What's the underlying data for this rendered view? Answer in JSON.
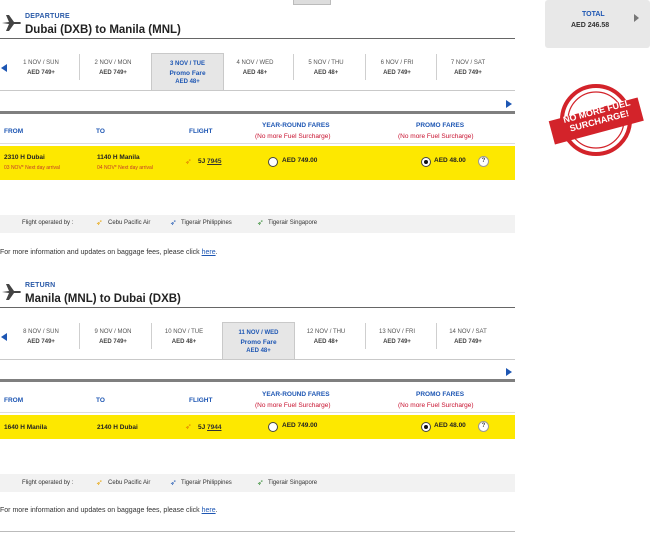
{
  "total": {
    "label": "TOTAL",
    "amount": "AED 246.58"
  },
  "stamp": {
    "line1": "NO MORE FUEL",
    "line2": "SURCHARGE!"
  },
  "departure": {
    "section_label": "DEPARTURE",
    "route": "Dubai (DXB) to Manila (MNL)",
    "dates": [
      {
        "date": "1 NOV / SUN",
        "price": "AED 749+"
      },
      {
        "date": "2 NOV / MON",
        "price": "AED 749+"
      },
      {
        "date": "3 NOV / TUE",
        "promo": "Promo Fare",
        "price": "AED 48+",
        "selected": true
      },
      {
        "date": "4 NOV / WED",
        "price": "AED 48+"
      },
      {
        "date": "5 NOV / THU",
        "price": "AED 48+"
      },
      {
        "date": "6 NOV / FRI",
        "price": "AED 749+"
      },
      {
        "date": "7 NOV / SAT",
        "price": "AED 749+"
      }
    ],
    "headers": {
      "from": "FROM",
      "to": "TO",
      "flight": "FLIGHT",
      "yr": "YEAR-ROUND FARES",
      "yr_sub": "(No more Fuel Surcharge)",
      "promo": "PROMO FARES",
      "promo_sub": "(No more Fuel Surcharge)"
    },
    "flight": {
      "dep": "2310 H  Dubai",
      "dep_sub": "03 NOV*   Next day arrival",
      "arr": "1140 H  Manila",
      "arr_sub": "04 NOV*   Next day arrival",
      "code": "5J",
      "number": "7945",
      "yr_price": "AED 749.00",
      "promo_price": "AED 48.00"
    },
    "operated_by": "Flight operated by :",
    "operators": [
      "Cebu Pacific Air",
      "Tigerair Philippines",
      "Tigerair Singapore"
    ],
    "info_text": "For more information and updates on baggage fees, please click ",
    "info_link": "here",
    "info_end": "."
  },
  "return": {
    "section_label": "RETURN",
    "route": "Manila (MNL) to Dubai (DXB)",
    "dates": [
      {
        "date": "8 NOV / SUN",
        "price": "AED 749+"
      },
      {
        "date": "9 NOV / MON",
        "price": "AED 749+"
      },
      {
        "date": "10 NOV / TUE",
        "price": "AED 48+"
      },
      {
        "date": "11 NOV / WED",
        "promo": "Promo Fare",
        "price": "AED 48+",
        "selected": true
      },
      {
        "date": "12 NOV / THU",
        "price": "AED 48+"
      },
      {
        "date": "13 NOV / FRI",
        "price": "AED 749+"
      },
      {
        "date": "14 NOV / SAT",
        "price": "AED 749+"
      }
    ],
    "headers": {
      "from": "FROM",
      "to": "TO",
      "flight": "FLIGHT",
      "yr": "YEAR-ROUND FARES",
      "yr_sub": "(No more Fuel Surcharge)",
      "promo": "PROMO FARES",
      "promo_sub": "(No more Fuel Surcharge)"
    },
    "flight": {
      "dep": "1640 H  Manila",
      "arr": "2140 H  Dubai",
      "code": "5J",
      "number": "7944",
      "yr_price": "AED 749.00",
      "promo_price": "AED 48.00"
    },
    "operated_by": "Flight operated by :",
    "operators": [
      "Cebu Pacific Air",
      "Tigerair Philippines",
      "Tigerair Singapore"
    ],
    "info_text": "For more information and updates on baggage fees, please click ",
    "info_link": "here",
    "info_end": "."
  },
  "colors": {
    "accent": "#1d56b3",
    "highlight": "#fde800",
    "alert": "#c8102e"
  }
}
